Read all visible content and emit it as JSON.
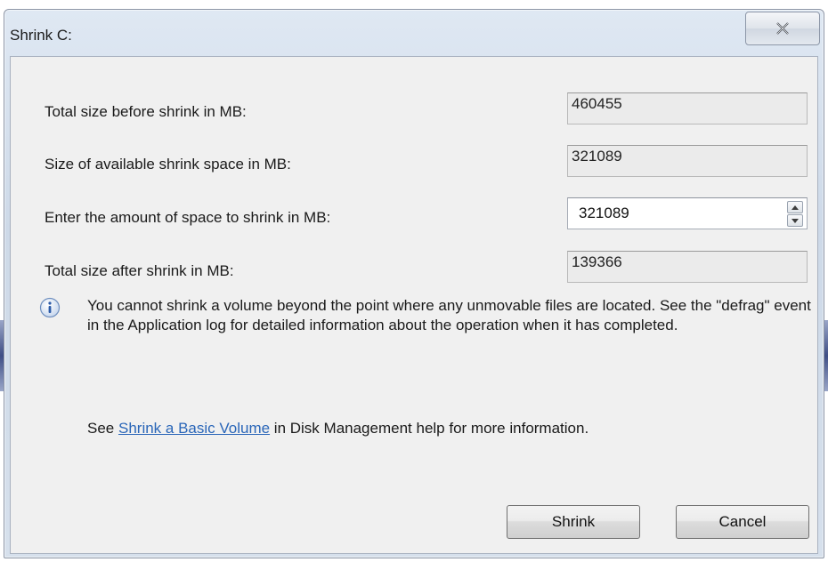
{
  "dialog": {
    "title": "Shrink C:",
    "close_glyph": "✕"
  },
  "fields": {
    "total_before": {
      "label": "Total size before shrink in MB:",
      "value": "460455"
    },
    "available": {
      "label": "Size of available shrink space in MB:",
      "value": "321089"
    },
    "amount": {
      "label": "Enter the amount of space to shrink in MB:",
      "value": "321089"
    },
    "total_after": {
      "label": "Total size after shrink in MB:",
      "value": "139366"
    }
  },
  "info": {
    "icon": "info-icon",
    "text": "You cannot shrink a volume beyond the point where any unmovable files are located. See the \"defrag\" event in the Application log for detailed information about the operation when it has completed."
  },
  "help": {
    "prefix": "See ",
    "link": "Shrink a Basic Volume",
    "suffix": " in Disk Management help for more information."
  },
  "buttons": {
    "shrink": "Shrink",
    "cancel": "Cancel"
  },
  "colors": {
    "link": "#2a66b8",
    "client_bg": "#f0f0f0",
    "frame": "#cdd9e8"
  }
}
